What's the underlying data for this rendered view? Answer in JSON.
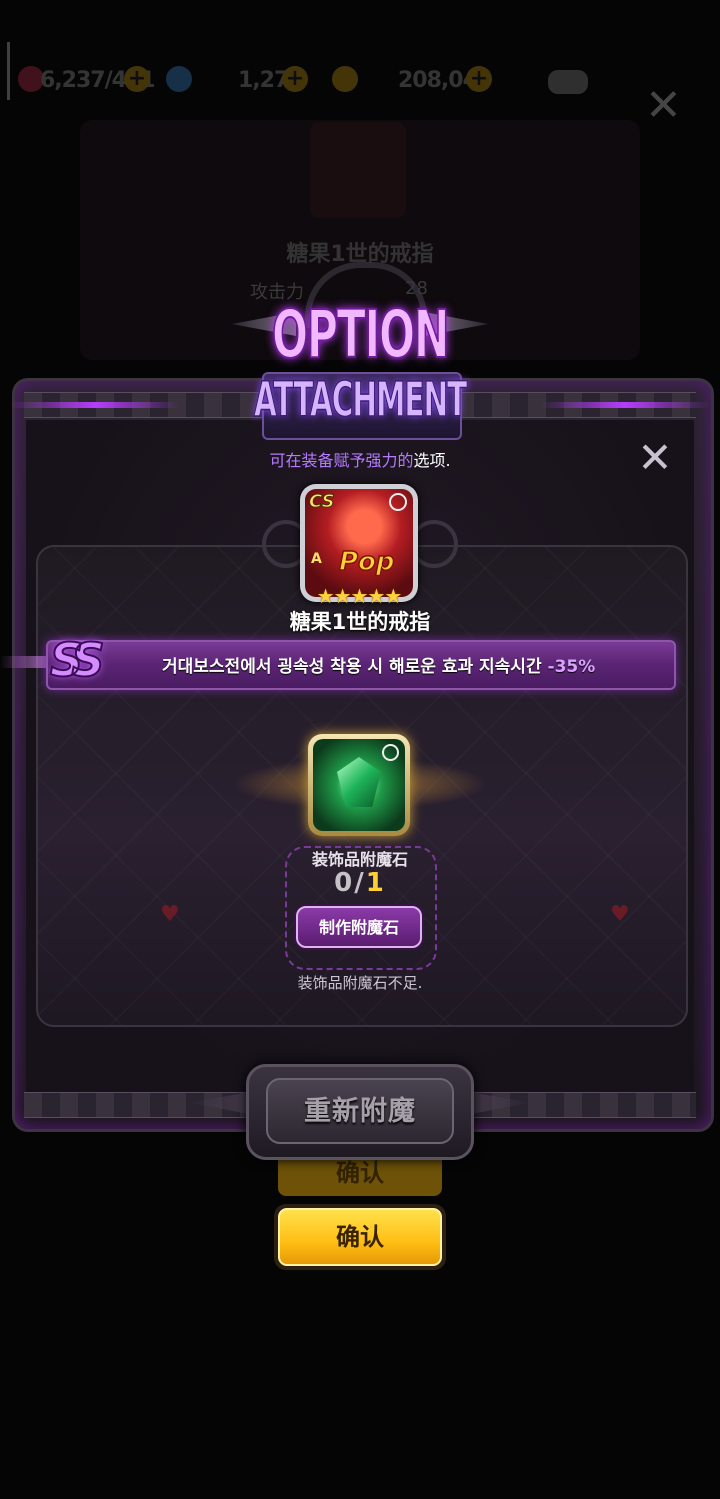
{
  "topbar": {
    "stamina": "6,237/421",
    "gems": "1,273",
    "gold": "208,045"
  },
  "background": {
    "item_name": "糖果1世的戒指",
    "stat_label": "攻击力",
    "stat_value": "28",
    "confirm_label": "确认"
  },
  "popup": {
    "title_line1": "OPTION",
    "title_line2": "ATTACHMENT",
    "subtitle_highlight": "可在装备赋予强力的",
    "subtitle_rest": "选项.",
    "item": {
      "name": "糖果1世的戒指",
      "stars": "★★★★★",
      "badge_cs": "CS",
      "badge_a": "A",
      "art_text": "Pop"
    },
    "option": {
      "grade": "SS",
      "text": "거대보스전에서 굉속성 착용 시 해로운 효과 지속시간 ",
      "value": "-35%"
    },
    "material": {
      "name": "装饰品附魔石",
      "have": "0",
      "separator": "/",
      "need": "1",
      "craft_label": "制作附魔石",
      "insufficient_text": "装饰品附魔石不足."
    },
    "reattach_label": "重新附魔",
    "confirm_label": "确认"
  },
  "colors": {
    "accent_purple": "#b67bff",
    "option_bar": "#5a2473",
    "confirm_gold": "#ffbe14",
    "need_yellow": "#ffcf33"
  },
  "icons": [
    "stamina-icon",
    "gem-icon",
    "gold-icon",
    "chat-icon",
    "close-icon",
    "lock-icon",
    "star-icon"
  ]
}
